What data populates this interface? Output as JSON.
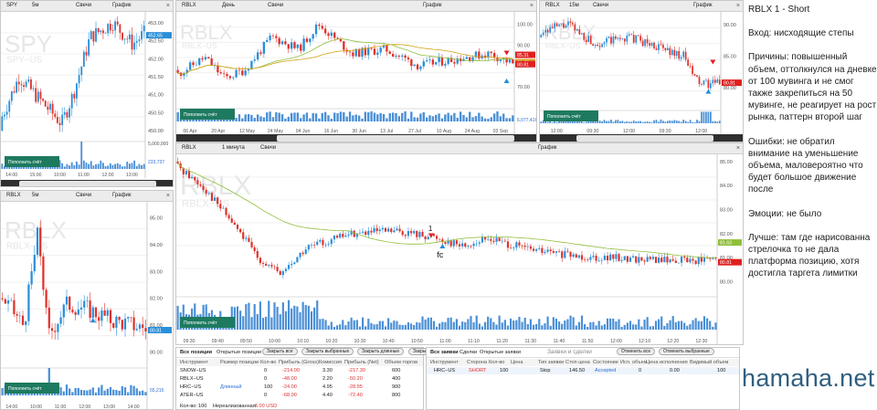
{
  "panels": {
    "spy": {
      "tab_label": "SPY",
      "timeframe": "5м",
      "type": "Свечи",
      "graph_label": "График",
      "watermark_big": "SPY",
      "watermark_small": "SPY−US",
      "price_tag": "452.65",
      "price_tag2": "452.20",
      "y_ticks": [
        "453.00",
        "452.50",
        "452.00",
        "451.50",
        "451.00",
        "450.50",
        "450.00"
      ],
      "vol_ticks": [
        "5,000,000",
        "233,737"
      ],
      "x_ticks": [
        "14:00",
        "15:00",
        "10:00",
        "11:00",
        "12:00",
        "13:00"
      ],
      "fill_button": "Пополнить счёт"
    },
    "rblx_day": {
      "tab_label": "RBLX",
      "timeframe": "День",
      "type": "Свечи",
      "graph_label": "График",
      "watermark_big": "RBLX",
      "watermark_small": "RBLX−US",
      "price_tags": [
        "85.31",
        "81.73",
        "80.81"
      ],
      "y_ticks": [
        "100.00",
        "90.00",
        "80.00",
        "70.00"
      ],
      "vol_tick": "6,077,416",
      "x_ticks": [
        "06 Apr",
        "20 Apr",
        "12 May",
        "24 May",
        "04 Jun",
        "16 Jun",
        "30 Jun",
        "13 Jul",
        "27 Jul",
        "10 Aug",
        "24 Aug",
        "03 Sep"
      ],
      "fill_button": "Пополнить счёт"
    },
    "rblx_15m": {
      "tab_label": "RBLX",
      "timeframe": "15м",
      "type": "Свечи",
      "graph_label": "График",
      "watermark_big": "RBLX",
      "watermark_small": "RBLX−US",
      "price_tag": "80.81",
      "y_ticks": [
        "90.00",
        "85.00",
        "80.00"
      ],
      "x_ticks": [
        "12:00",
        "09:30",
        "12:00",
        "09:30",
        "12:00"
      ],
      "fill_button": "Пополнить счёт"
    },
    "rblx_5m": {
      "tab_label": "RBLX",
      "timeframe": "5м",
      "type": "Свечи",
      "graph_label": "График",
      "watermark_big": "RBLX",
      "watermark_small": "RBLX−US",
      "price_tag": "80.81",
      "y_ticks": [
        "85.00",
        "84.00",
        "83.00",
        "82.00",
        "81.00",
        "80.00"
      ],
      "vol_tick": "55,215",
      "x_ticks": [
        "14:00",
        "10:00",
        "11:00",
        "12:00",
        "13:00",
        "14:00"
      ],
      "fill_button": "Пополнить счёт"
    },
    "rblx_1m": {
      "tab_label": "RBLX",
      "timeframe": "1 минута",
      "type": "Свечи",
      "graph_label": "График",
      "watermark_big": "RBLX",
      "watermark_small": "RBLX−US",
      "price_tags": [
        "81.63",
        "80.81"
      ],
      "y_ticks": [
        "85.00",
        "84.00",
        "83.00",
        "82.00",
        "81.00",
        "80.00"
      ],
      "x_ticks": [
        "09:30",
        "09:40",
        "09:50",
        "10:00",
        "10:10",
        "10:20",
        "10:30",
        "10:40",
        "10:50",
        "11:00",
        "11:10",
        "11:20",
        "11:30",
        "11:40",
        "11:50",
        "12:00",
        "12:10",
        "12:20",
        "12:30"
      ],
      "marker_1": "1",
      "marker_fc": "fc",
      "fill_button": "Пополнить счёт"
    }
  },
  "positions": {
    "tabs": [
      "Все позиции",
      "Открытые позиции"
    ],
    "buttons": [
      "Закрыть все",
      "Закрыть выбранные",
      "Закрыть длинные",
      "Закры"
    ],
    "headers": [
      "Инструмент",
      "Размер позиции",
      "Кол-во",
      "Прибыль (Gross)",
      "Комиссия",
      "Прибыль (Net)",
      "Объем торгов"
    ],
    "rows": [
      {
        "instrument": "SNOW−US",
        "side": "",
        "qty": "0",
        "gross": "-214.00",
        "fee": "3.30",
        "net": "-217.30",
        "volume": "600"
      },
      {
        "instrument": "RBLX−US",
        "side": "",
        "qty": "0",
        "gross": "-48.00",
        "fee": "2.20",
        "net": "-50.20",
        "volume": "400"
      },
      {
        "instrument": "HRC−US",
        "side": "Длинный",
        "qty": "100",
        "gross": "-24.00",
        "fee": "4.95",
        "net": "-28.95",
        "volume": "900"
      },
      {
        "instrument": "ATER−US",
        "side": "",
        "qty": "0",
        "gross": "-68.00",
        "fee": "4.40",
        "net": "-72.40",
        "volume": "800"
      }
    ],
    "footer_qty_label": "Кол-во:",
    "footer_qty": "100",
    "footer_pnl_label": "Нереализованная:",
    "footer_pnl": "-6.00 USD"
  },
  "orders": {
    "tabs": [
      "Все заявки",
      "Сделки",
      "Открытые заявки"
    ],
    "title": "Заявки и сделки",
    "buttons": [
      "Отменить все",
      "Отменить выбранные"
    ],
    "headers": [
      "Инструмент",
      "Сторона",
      "Кол-во",
      "Цена",
      "Тип заявки",
      "Стоп цена",
      "Состояние",
      "Исп. объем",
      "Цена исполнения",
      "Видимый объем"
    ],
    "row": {
      "instrument": "HRC−US",
      "side": "SHORT",
      "qty": "100",
      "price": "",
      "type": "Stop",
      "stop": "146.50",
      "state": "Accepted",
      "filled": "0",
      "exec_price": "0.00",
      "visible": "100"
    }
  },
  "notes": {
    "title": "RBLX 1 - Short",
    "entry": "Вход: нисходящие степы",
    "reasons": "Причины: повышенный объем, оттолкнулся на дневке от 100 мувинга и не смог также закрепиться на 50 мувинге, не реагирует на рост рынка, паттерн второй шаг",
    "errors": "Ошибки: не обратил внимание на уменьшение объема, маловероятно что будет большое движение после",
    "emotions": "Эмоции: не было",
    "better": "Лучше: там где нарисованна стрелочка то не дала платформа позицию, хотя достигла таргета лимитки"
  },
  "brand": "hamaha.net",
  "colors": {
    "up": "#2a8fd9",
    "down": "#e0322b",
    "ma50": "#8fbf3a",
    "ma100": "#d4a017",
    "volume": "#4a8fd6",
    "button": "#1e7a5f",
    "marker_blue": "#1f8fe0",
    "marker_red": "#e02020"
  }
}
